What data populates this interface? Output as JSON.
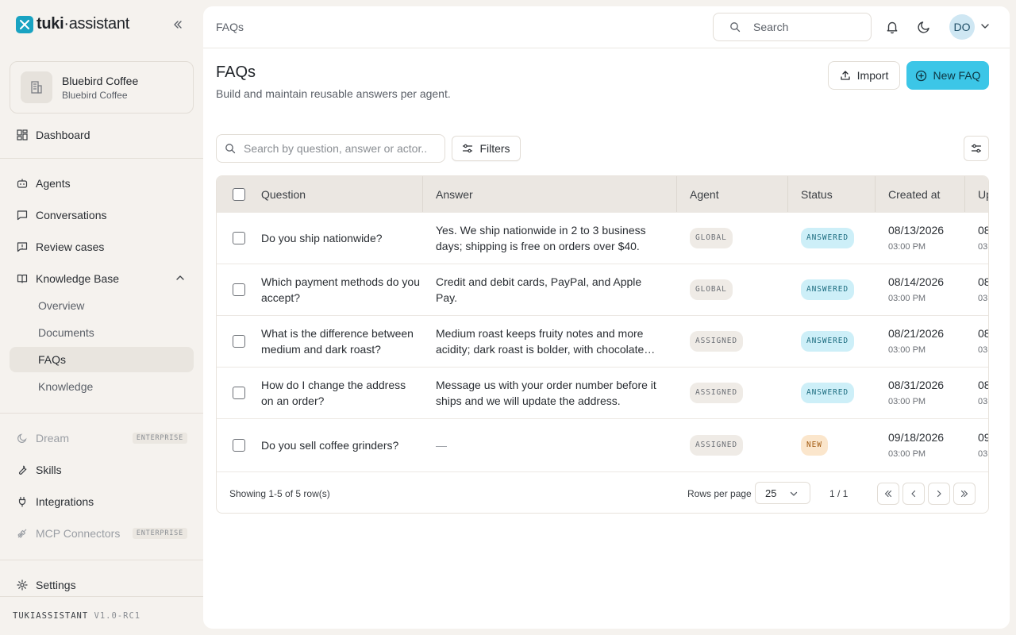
{
  "brand": {
    "name_bold": "tuki",
    "name_sep": "·",
    "name_light": "assistant"
  },
  "workspace": {
    "name": "Bluebird Coffee",
    "sub": "Bluebird Coffee"
  },
  "sidebar": {
    "dashboard": "Dashboard",
    "agents": "Agents",
    "conversations": "Conversations",
    "review_cases": "Review cases",
    "knowledge_base": "Knowledge Base",
    "kb_items": [
      "Overview",
      "Documents",
      "FAQs",
      "Knowledge"
    ],
    "dream": "Dream",
    "skills": "Skills",
    "integrations": "Integrations",
    "mcp": "MCP Connectors",
    "enterprise_badge": "ENTERPRISE",
    "settings": "Settings"
  },
  "version": {
    "name": "TUKIASSISTANT",
    "number": "V1.0-RC1"
  },
  "topbar": {
    "breadcrumb": "FAQs",
    "search_label": "Search",
    "avatar_initials": "DO"
  },
  "page": {
    "title": "FAQs",
    "subtitle": "Build and maintain reusable answers per agent.",
    "import_label": "Import",
    "new_label": "New FAQ",
    "search_placeholder": "Search by question, answer or actor..",
    "filters_label": "Filters"
  },
  "table": {
    "headers": [
      "Question",
      "Answer",
      "Agent",
      "Status",
      "Created at",
      "Up"
    ],
    "rows": [
      {
        "question": "Do you ship nationwide?",
        "answer": "Yes. We ship nationwide in 2 to 3 business days; shipping is free on orders over $40.",
        "agent": "GLOBAL",
        "status": "ANSWERED",
        "created_date": "08/13/2026",
        "created_time": "03:00 PM",
        "updated_date": "08",
        "updated_time": "03"
      },
      {
        "question": "Which payment methods do you accept?",
        "answer": "Credit and debit cards, PayPal, and Apple Pay.",
        "agent": "GLOBAL",
        "status": "ANSWERED",
        "created_date": "08/14/2026",
        "created_time": "03:00 PM",
        "updated_date": "08",
        "updated_time": "03"
      },
      {
        "question": "What is the difference between medium and dark roast?",
        "answer": "Medium roast keeps fruity notes and more acidity; dark roast is bolder, with chocolate notes.",
        "agent": "ASSIGNED",
        "status": "ANSWERED",
        "created_date": "08/21/2026",
        "created_time": "03:00 PM",
        "updated_date": "08",
        "updated_time": "03"
      },
      {
        "question": "How do I change the address on an order?",
        "answer": "Message us with your order number before it ships and we will update the address.",
        "agent": "ASSIGNED",
        "status": "ANSWERED",
        "created_date": "08/31/2026",
        "created_time": "03:00 PM",
        "updated_date": "08",
        "updated_time": "03"
      },
      {
        "question": "Do you sell coffee grinders?",
        "answer": "—",
        "agent": "ASSIGNED",
        "status": "NEW",
        "created_date": "09/18/2026",
        "created_time": "03:00 PM",
        "updated_date": "09",
        "updated_time": "03"
      }
    ]
  },
  "footer": {
    "showing": "Showing 1-5 of 5 row(s)",
    "rows_per_page_label": "Rows per page",
    "rows_per_page": "25",
    "page_indicator": "1 / 1"
  },
  "colors": {
    "accent": "#3cc6e7",
    "brand": "#19a3c2",
    "answered": "#cdeff8",
    "new": "#fbe6cc"
  },
  "icons": [
    "logo-icon",
    "collapse-icon",
    "building-icon",
    "dashboard-icon",
    "bot-icon",
    "message-icon",
    "review-icon",
    "book-icon",
    "chevron-up-icon",
    "dream-icon",
    "wrench-icon",
    "plug-icon",
    "mcp-icon",
    "gear-icon",
    "search-icon",
    "bell-icon",
    "moon-icon",
    "chevron-down-icon",
    "upload-icon",
    "plus-circle-icon",
    "filter-icon",
    "settings-sliders-icon",
    "first-page-icon",
    "prev-page-icon",
    "next-page-icon",
    "last-page-icon"
  ]
}
